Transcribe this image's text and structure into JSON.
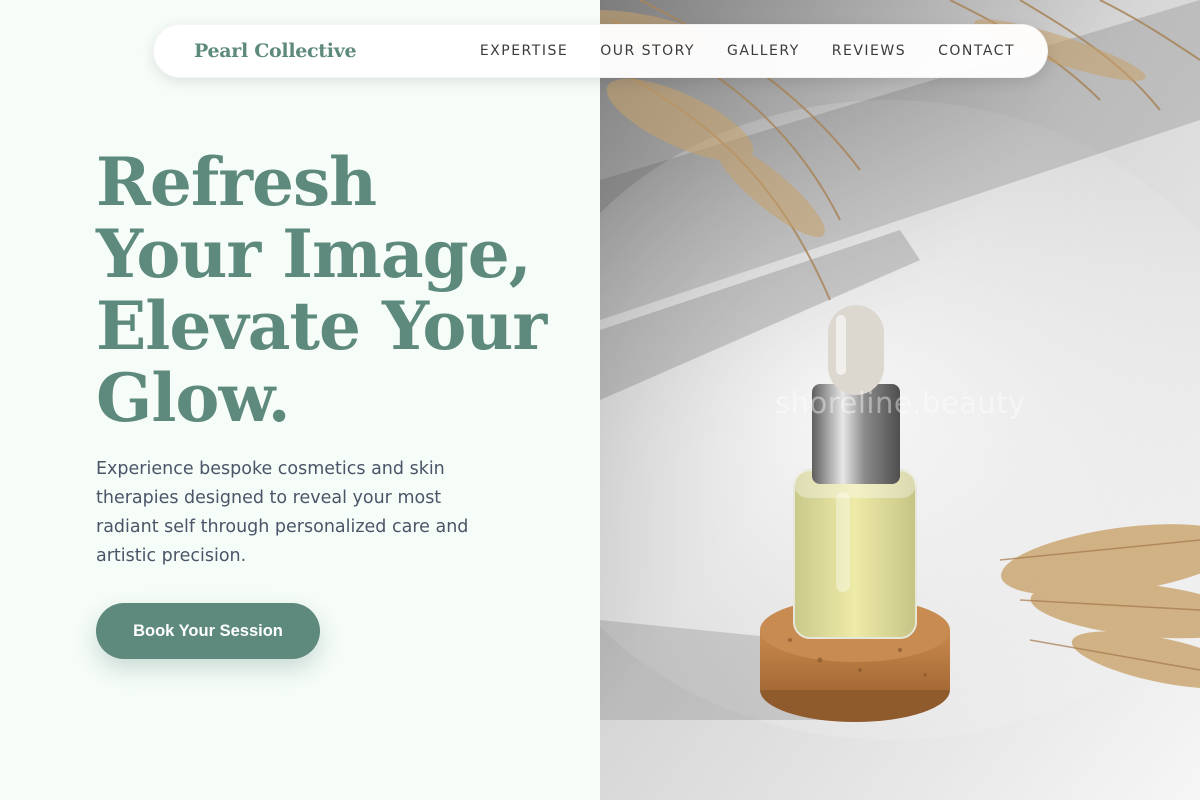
{
  "brand": "Pearl Collective",
  "nav": [
    "EXPERTISE",
    "OUR STORY",
    "GALLERY",
    "REVIEWS",
    "CONTACT"
  ],
  "hero": {
    "title_lines": [
      "Refresh",
      "Your Image,",
      "Elevate Your",
      "Glow."
    ],
    "description": "Experience bespoke cosmetics and skin therapies designed to reveal your most radiant self through personalized care and artistic precision.",
    "cta_label": "Book Your Session"
  },
  "image": {
    "watermark": "shoreline.beauty"
  },
  "colors": {
    "accent": "#5e8a7d",
    "background": "#f6fcf8",
    "body_text": "#4a5568",
    "nav_text": "#3b3b3b"
  },
  "icons": [
    "serum-bottle-photo"
  ]
}
